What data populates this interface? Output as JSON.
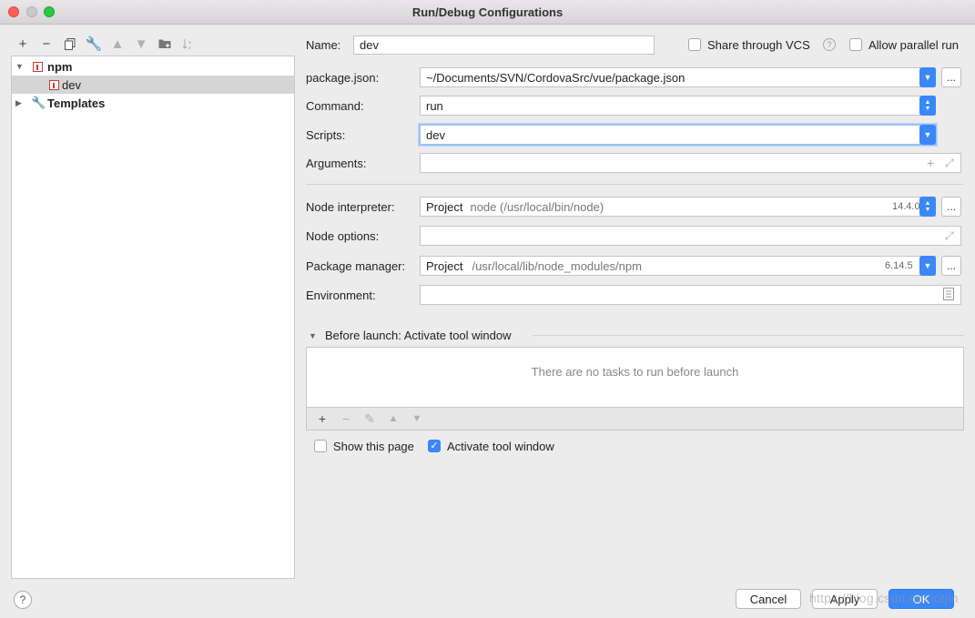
{
  "window": {
    "title": "Run/Debug Configurations"
  },
  "left_toolbar": {
    "icons": [
      "add-icon",
      "remove-icon",
      "copy-icon",
      "wrench-icon",
      "move-up-icon",
      "move-down-icon",
      "new-folder-icon",
      "sort-icon"
    ]
  },
  "tree": {
    "npm_label": "npm",
    "dev_label": "dev",
    "templates_label": "Templates"
  },
  "form": {
    "name_label": "Name:",
    "name_value": "dev",
    "share_vcs_label": "Share through VCS",
    "share_vcs_checked": false,
    "allow_parallel_label": "Allow parallel run",
    "allow_parallel_checked": false,
    "package_json_label": "package.json:",
    "package_json_value": "~/Documents/SVN/CordovaSrc/vue/package.json",
    "command_label": "Command:",
    "command_value": "run",
    "scripts_label": "Scripts:",
    "scripts_value": "dev",
    "arguments_label": "Arguments:",
    "arguments_value": "",
    "node_interpreter_label": "Node interpreter:",
    "node_interpreter_prefix": "Project",
    "node_interpreter_path": "node (/usr/local/bin/node)",
    "node_interpreter_version": "14.4.0",
    "node_options_label": "Node options:",
    "node_options_value": "",
    "package_manager_label": "Package manager:",
    "package_manager_prefix": "Project",
    "package_manager_path": "/usr/local/lib/node_modules/npm",
    "package_manager_version": "6.14.5",
    "environment_label": "Environment:",
    "environment_value": "",
    "ellipsis": "..."
  },
  "before_launch": {
    "header": "Before launch: Activate tool window",
    "empty_text": "There are no tasks to run before launch"
  },
  "options": {
    "show_page_label": "Show this page",
    "show_page_checked": false,
    "activate_tool_label": "Activate tool window",
    "activate_tool_checked": true
  },
  "buttons": {
    "help": "?",
    "cancel": "Cancel",
    "apply": "Apply",
    "ok": "OK"
  },
  "watermark": "https://blog.csdn.net/iotjin",
  "colors": {
    "accent": "#3a87f7",
    "selection": "#d5d5d5",
    "npm": "#cb3837"
  }
}
